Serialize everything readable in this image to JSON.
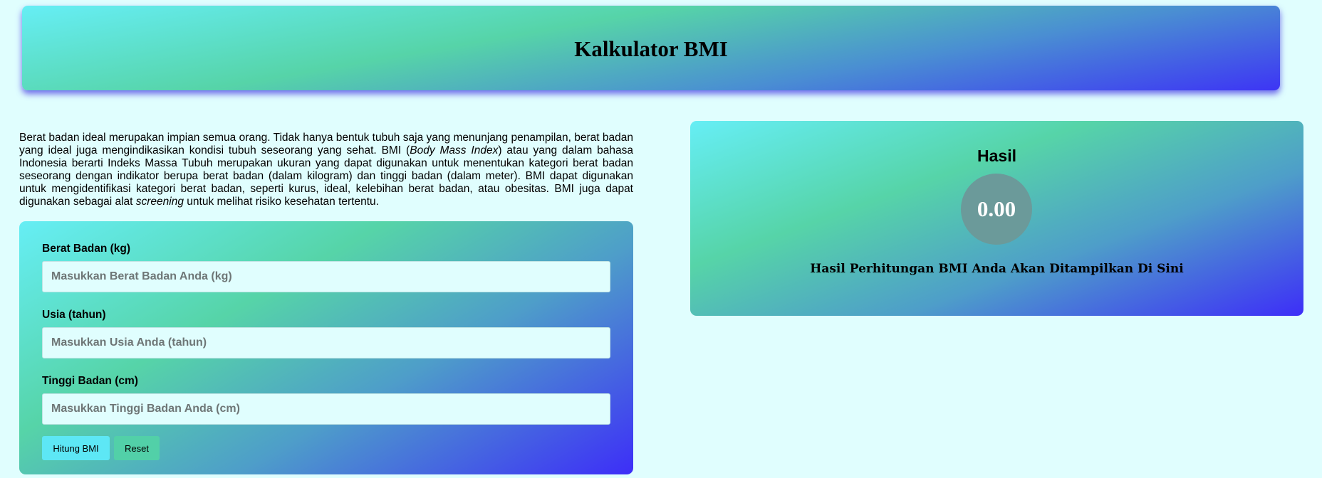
{
  "header": {
    "title": "Kalkulator BMI"
  },
  "intro": {
    "part1": "Berat badan ideal merupakan impian semua orang. Tidak hanya bentuk tubuh saja yang menunjang penampilan, berat badan yang ideal juga mengindikasikan kondisi tubuh seseorang yang sehat. BMI (",
    "em1": "Body Mass Index",
    "part2": ") atau yang dalam bahasa Indonesia berarti Indeks Massa Tubuh merupakan ukuran yang dapat digunakan untuk menentukan kategori berat badan seseorang dengan indikator berupa berat badan (dalam kilogram) dan tinggi badan (dalam meter). BMI dapat digunakan untuk mengidentifikasi kategori berat badan, seperti kurus, ideal, kelebihan berat badan, atau obesitas. BMI juga dapat digunakan sebagai alat ",
    "em2": "screening",
    "part3": " untuk melihat risiko kesehatan tertentu."
  },
  "form": {
    "weight": {
      "label": "Berat Badan (kg)",
      "value": "",
      "placeholder": "Masukkan Berat Badan Anda (kg)"
    },
    "age": {
      "label": "Usia (tahun)",
      "value": "",
      "placeholder": "Masukkan Usia Anda (tahun)"
    },
    "height": {
      "label": "Tinggi Badan (cm)",
      "value": "",
      "placeholder": "Masukkan Tinggi Badan Anda (cm)"
    },
    "calculate_label": "Hitung BMI",
    "reset_label": "Reset"
  },
  "result": {
    "title": "Hasil",
    "score": "0.00",
    "message": "Hasil Perhitungan BMI Anda Akan Ditampilkan Di Sini"
  },
  "colors": {
    "page_background": "#e0fefe",
    "gradient_cyan": "#66eef5",
    "gradient_green": "#56d4a8",
    "gradient_blue": "#3d2ef8",
    "score_circle": "#6b9a9a",
    "button_calculate": "#5de7f5",
    "button_reset": "#52d0a8"
  }
}
